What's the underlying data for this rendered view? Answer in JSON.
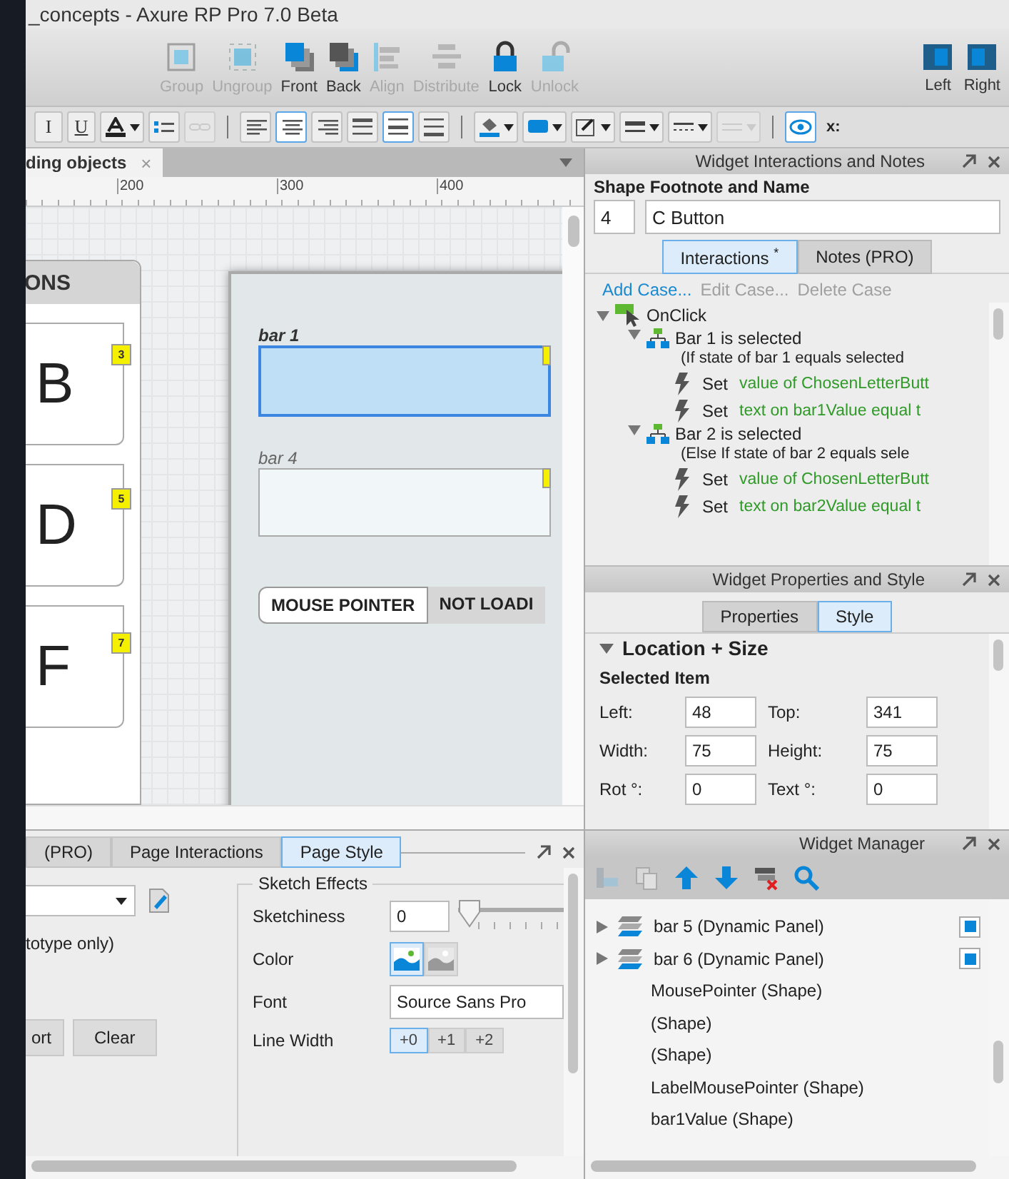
{
  "window": {
    "title": "_concepts - Axure RP Pro 7.0 Beta"
  },
  "toolbar": {
    "buttons": [
      {
        "kind": "group",
        "label": "Group",
        "disabled": true
      },
      {
        "kind": "ungroup",
        "label": "Ungroup",
        "disabled": true
      },
      {
        "kind": "front",
        "label": "Front",
        "disabled": false
      },
      {
        "kind": "back",
        "label": "Back",
        "disabled": false
      },
      {
        "kind": "align",
        "label": "Align",
        "disabled": true
      },
      {
        "kind": "distribute",
        "label": "Distribute",
        "disabled": true
      },
      {
        "kind": "lock",
        "label": "Lock",
        "disabled": false
      },
      {
        "kind": "unlock",
        "label": "Unlock",
        "disabled": true
      }
    ],
    "panel_buttons": [
      {
        "kind": "left",
        "label": "Left",
        "disabled": false
      },
      {
        "kind": "right",
        "label": "Right",
        "disabled": false
      }
    ]
  },
  "format_bar": {
    "buttons": [
      {
        "kind": "italic",
        "label": "I",
        "selected": false,
        "disabled": false
      },
      {
        "kind": "underline",
        "label": "U",
        "selected": false,
        "disabled": false
      },
      {
        "kind": "font_color",
        "selected": false,
        "disabled": false
      },
      {
        "kind": "bullets",
        "selected": false,
        "disabled": false
      },
      {
        "kind": "link",
        "selected": false,
        "disabled": true
      },
      {
        "kind": "align_left",
        "selected": false,
        "disabled": false
      },
      {
        "kind": "align_center",
        "selected": true,
        "disabled": false
      },
      {
        "kind": "align_right",
        "selected": false,
        "disabled": false
      },
      {
        "kind": "align_top",
        "selected": false,
        "disabled": false
      },
      {
        "kind": "align_middle",
        "selected": true,
        "disabled": false
      },
      {
        "kind": "align_bottom",
        "selected": false,
        "disabled": false
      },
      {
        "kind": "fill_color",
        "selected": false,
        "disabled": false
      },
      {
        "kind": "line_color",
        "selected": false,
        "disabled": false
      },
      {
        "kind": "border",
        "selected": false,
        "disabled": false
      },
      {
        "kind": "line_weight",
        "selected": false,
        "disabled": false
      },
      {
        "kind": "line_style",
        "selected": false,
        "disabled": false
      },
      {
        "kind": "arrow_style",
        "selected": false,
        "disabled": true
      },
      {
        "kind": "visibility",
        "selected": true,
        "disabled": false
      }
    ],
    "x_label": "x:"
  },
  "document_tab": {
    "label": "ding objects",
    "close": "×"
  },
  "ruler": {
    "labels": [
      "200",
      "300",
      "400"
    ]
  },
  "canvas": {
    "panel_header": "ONS",
    "letter_cards": [
      {
        "letter": "B",
        "footnote": "3"
      },
      {
        "letter": "D",
        "footnote": "5"
      },
      {
        "letter": "F",
        "footnote": "7"
      }
    ],
    "bars": [
      {
        "label": "bar 1",
        "selected": true
      },
      {
        "label": "bar 4",
        "selected": false
      }
    ],
    "breadcrumb": [
      "MOUSE POINTER",
      "NOT LOADI"
    ]
  },
  "interactions_panel": {
    "title": "Widget Interactions and Notes",
    "footnote_label": "Shape Footnote and Name",
    "footnote": "4",
    "name": "C Button",
    "tabs": [
      {
        "label": "Interactions $^{*}$",
        "selected": true
      },
      {
        "label": "Notes (PRO)",
        "selected": false
      }
    ],
    "case_actions": [
      {
        "label": "Add Case...",
        "disabled": false
      },
      {
        "label": "Edit Case...",
        "disabled": true
      },
      {
        "label": "Delete Case",
        "disabled": true
      }
    ],
    "event": {
      "label": "OnClick",
      "expanded": true
    },
    "cases": [
      {
        "name": "Bar 1 is selected",
        "condition": "(If state of bar 1 equals selected",
        "expanded": true,
        "actions": [
          {
            "verb": "Set",
            "target": "value of ChosenLetterButt"
          },
          {
            "verb": "Set",
            "target": "text on bar1Value equal t"
          }
        ]
      },
      {
        "name": "Bar 2 is selected",
        "condition": "(Else If state of bar 2 equals sele",
        "expanded": true,
        "actions": [
          {
            "verb": "Set",
            "target": "value of ChosenLetterButt"
          },
          {
            "verb": "Set",
            "target": "text on bar2Value equal t"
          }
        ]
      }
    ]
  },
  "properties_panel": {
    "title": "Widget Properties and Style",
    "tabs": [
      {
        "label": "Properties",
        "selected": false
      },
      {
        "label": "Style",
        "selected": true
      }
    ],
    "section": {
      "label": "Location + Size",
      "expanded": true
    },
    "subheading": "Selected Item",
    "fields": [
      {
        "label": "Left:",
        "value": "48"
      },
      {
        "label": "Top:",
        "value": "341"
      },
      {
        "label": "Width:",
        "value": "75"
      },
      {
        "label": "Height:",
        "value": "75"
      },
      {
        "label": "Rot °:",
        "value": "0"
      },
      {
        "label": "Text °:",
        "value": "0"
      }
    ]
  },
  "page_panel": {
    "tabs": [
      {
        "label": "(PRO)",
        "selected": false
      },
      {
        "label": "Page Interactions",
        "selected": false
      },
      {
        "label": "Page Style",
        "selected": true
      }
    ],
    "note": "totype only)",
    "buttons": [
      "ort",
      "Clear"
    ],
    "sketch": {
      "legend": "Sketch Effects",
      "sketchiness_label": "Sketchiness",
      "sketchiness": "0",
      "level": 0,
      "color_label": "Color",
      "color_modes": [
        {
          "kind": "color",
          "selected": true
        },
        {
          "kind": "grayscale",
          "selected": false
        }
      ],
      "font_label": "Font",
      "font": "Source Sans Pro",
      "line_width_label": "Line Width",
      "line_widths": [
        {
          "label": "+0",
          "selected": true
        },
        {
          "label": "+1",
          "selected": false
        },
        {
          "label": "+2",
          "selected": false
        }
      ]
    }
  },
  "widget_manager": {
    "title": "Widget Manager",
    "tools": [
      {
        "kind": "add_folder",
        "disabled": true
      },
      {
        "kind": "copy",
        "disabled": true
      },
      {
        "kind": "up",
        "disabled": false
      },
      {
        "kind": "down",
        "disabled": false
      },
      {
        "kind": "filter",
        "disabled": false
      },
      {
        "kind": "search",
        "disabled": false
      }
    ],
    "items": [
      {
        "label": "bar 5 (Dynamic Panel)",
        "kind": "dynamic_panel",
        "expanded": false,
        "checked": true
      },
      {
        "label": "bar 6 (Dynamic Panel)",
        "kind": "dynamic_panel",
        "expanded": false,
        "checked": true
      },
      {
        "label": "MousePointer (Shape)",
        "kind": "shape"
      },
      {
        "label": "(Shape)",
        "kind": "shape"
      },
      {
        "label": "(Shape)",
        "kind": "shape"
      },
      {
        "label": "LabelMousePointer (Shape)",
        "kind": "shape"
      },
      {
        "label": "bar1Value (Shape)",
        "kind": "shape"
      }
    ]
  }
}
